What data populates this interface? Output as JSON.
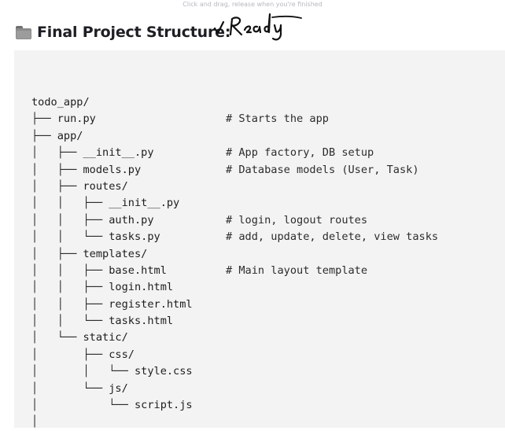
{
  "hint": "Click and drag, release when you're finished",
  "heading": {
    "icon": "folder-icon",
    "title": "Final Project Structure:",
    "handwritten_note": "✓ Ready"
  },
  "tree": [
    {
      "prefix": "",
      "name": "todo_app/",
      "comment": ""
    },
    {
      "prefix": "├── ",
      "name": "run.py",
      "comment": "# Starts the app"
    },
    {
      "prefix": "├── ",
      "name": "app/",
      "comment": ""
    },
    {
      "prefix": "│   ├── ",
      "name": "__init__.py",
      "comment": "# App factory, DB setup"
    },
    {
      "prefix": "│   ├── ",
      "name": "models.py",
      "comment": "# Database models (User, Task)"
    },
    {
      "prefix": "│   ├── ",
      "name": "routes/",
      "comment": ""
    },
    {
      "prefix": "│   │   ├── ",
      "name": "__init__.py",
      "comment": ""
    },
    {
      "prefix": "│   │   ├── ",
      "name": "auth.py",
      "comment": "# login, logout routes"
    },
    {
      "prefix": "│   │   └── ",
      "name": "tasks.py",
      "comment": "# add, update, delete, view tasks"
    },
    {
      "prefix": "│   ├── ",
      "name": "templates/",
      "comment": ""
    },
    {
      "prefix": "│   │   ├── ",
      "name": "base.html",
      "comment": "# Main layout template"
    },
    {
      "prefix": "│   │   ├── ",
      "name": "login.html",
      "comment": ""
    },
    {
      "prefix": "│   │   ├── ",
      "name": "register.html",
      "comment": ""
    },
    {
      "prefix": "│   │   └── ",
      "name": "tasks.html",
      "comment": ""
    },
    {
      "prefix": "│   └── ",
      "name": "static/",
      "comment": ""
    },
    {
      "prefix": "│       ├── ",
      "name": "css/",
      "comment": ""
    },
    {
      "prefix": "│       │   └── ",
      "name": "style.css",
      "comment": ""
    },
    {
      "prefix": "│       └── ",
      "name": "js/",
      "comment": ""
    },
    {
      "prefix": "│           └── ",
      "name": "script.js",
      "comment": ""
    },
    {
      "prefix": "│",
      "name": "",
      "comment": ""
    }
  ]
}
